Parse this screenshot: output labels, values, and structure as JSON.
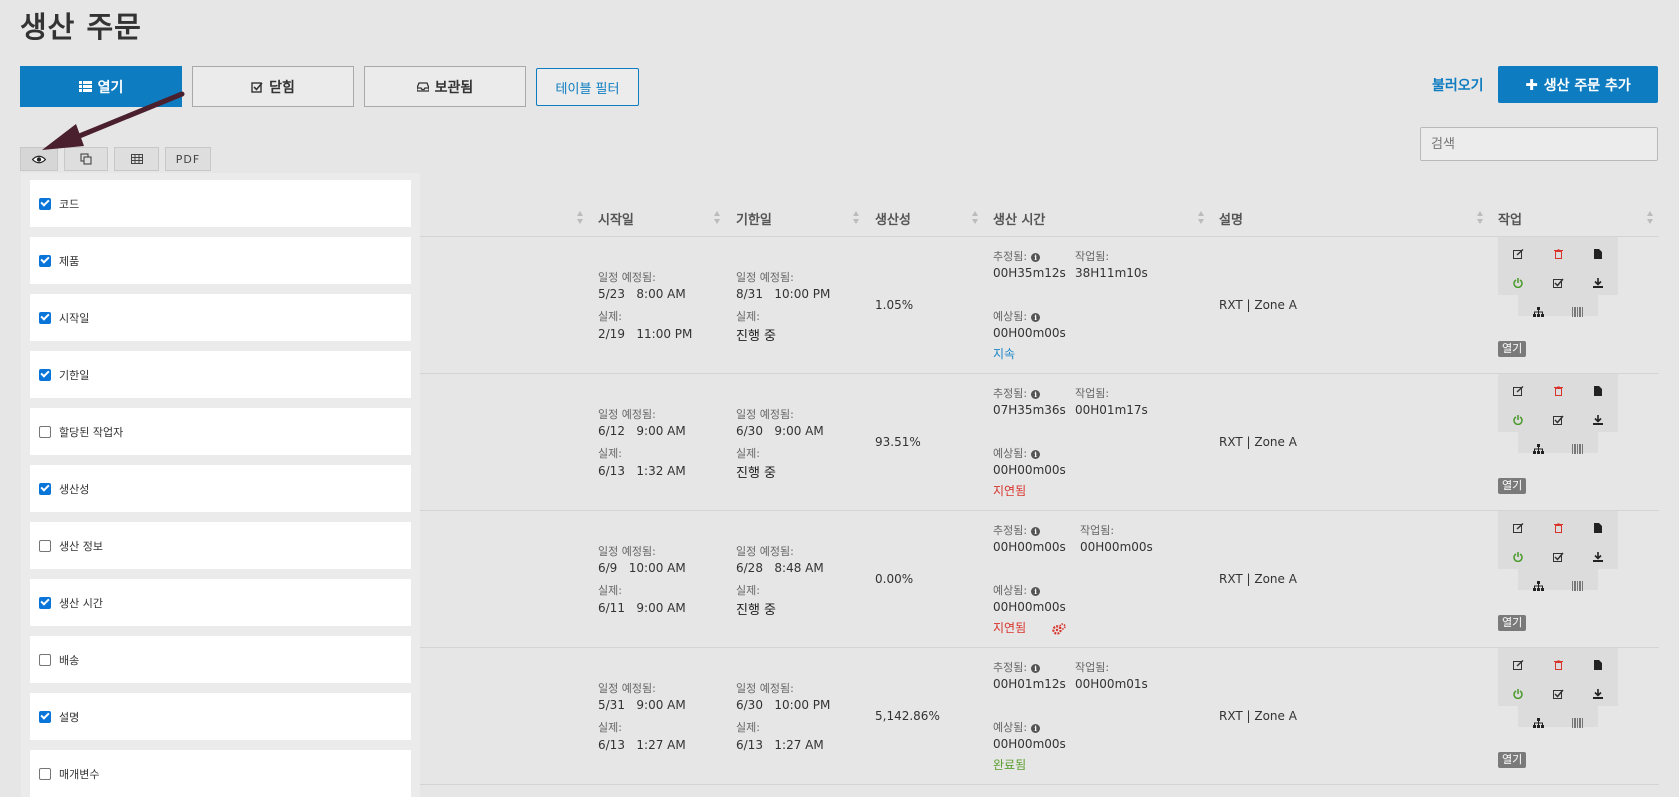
{
  "page": {
    "title": "생산 주문"
  },
  "tabs": [
    {
      "label": "열기",
      "icon": "list-icon"
    },
    {
      "label": "닫힘",
      "icon": "check-square-icon"
    },
    {
      "label": "보관됨",
      "icon": "inbox-icon"
    }
  ],
  "toolbar": {
    "filter_label": "테이블 필터",
    "import_label": "불러오기",
    "add_label": "생산 주문 추가",
    "search_placeholder": "검색",
    "pdf_label": "PDF"
  },
  "columns_panel": {
    "items": [
      {
        "label": "코드",
        "checked": true
      },
      {
        "label": "제품",
        "checked": true
      },
      {
        "label": "시작일",
        "checked": true
      },
      {
        "label": "기한일",
        "checked": true
      },
      {
        "label": "할당된 작업자",
        "checked": false
      },
      {
        "label": "생산성",
        "checked": true
      },
      {
        "label": "생산 정보",
        "checked": false
      },
      {
        "label": "생산 시간",
        "checked": true
      },
      {
        "label": "배송",
        "checked": false
      },
      {
        "label": "설명",
        "checked": true
      },
      {
        "label": "매개변수",
        "checked": false
      }
    ]
  },
  "table": {
    "headers": {
      "start": "시작일",
      "due": "기한일",
      "productivity": "생산성",
      "production_time": "생산 시간",
      "description": "설명",
      "actions": "작업"
    },
    "labels": {
      "scheduled": "일정 예정됨:",
      "actual": "실제:",
      "estimated": "추정됨:",
      "worked": "작업됨:",
      "expected": "예상됨:",
      "open_badge": "열기"
    },
    "rows": [
      {
        "start_scheduled": "5/23   8:00 AM",
        "start_actual": "2/19   11:00 PM",
        "due_scheduled": "8/31   10:00 PM",
        "due_actual": "진행 중",
        "productivity": "1.05%",
        "estimated": "00H35m12s",
        "worked": "38H11m10s",
        "expected": "00H00m00s",
        "status": "지속",
        "status_color": "#1a86c8",
        "description": "RXT | Zone A",
        "gear": false
      },
      {
        "start_scheduled": "6/12   9:00 AM",
        "start_actual": "6/13   1:32 AM",
        "due_scheduled": "6/30   9:00 AM",
        "due_actual": "진행 중",
        "productivity": "93.51%",
        "estimated": "07H35m36s",
        "worked": "00H01m17s",
        "expected": "00H00m00s",
        "status": "지연됨",
        "status_color": "#d9342b",
        "description": "RXT | Zone A",
        "gear": false
      },
      {
        "start_scheduled": "6/9   10:00 AM",
        "start_actual": "6/11   9:00 AM",
        "due_scheduled": "6/28   8:48 AM",
        "due_actual": "진행 중",
        "productivity": "0.00%",
        "estimated": "00H00m00s",
        "worked": "00H00m00s",
        "expected": "00H00m00s",
        "status": "지연됨",
        "status_color": "#d9342b",
        "description": "RXT | Zone A",
        "gear": true
      },
      {
        "start_scheduled": "5/31   9:00 AM",
        "start_actual": "6/13   1:27 AM",
        "due_scheduled": "6/30   10:00 PM",
        "due_actual": "6/13   1:27 AM",
        "productivity": "5,142.86%",
        "estimated": "00H01m12s",
        "worked": "00H00m01s",
        "expected": "00H00m00s",
        "status": "완료됨",
        "status_color": "#5a9e2f",
        "description": "RXT | Zone A",
        "gear": false
      }
    ]
  },
  "colors": {
    "accent": "#0d7cc0",
    "arrow": "#4a1f2e"
  }
}
